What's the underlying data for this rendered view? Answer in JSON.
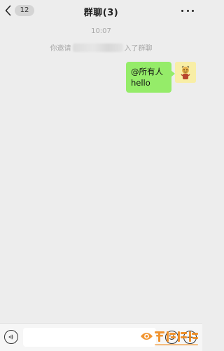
{
  "header": {
    "back_badge": "12",
    "title": "群聊(3)"
  },
  "messages": {
    "timestamp": "10:07",
    "system_prefix": "你邀请",
    "system_suffix": "入了群聊",
    "bubble_line1": "@所有人",
    "bubble_line2": "hello"
  },
  "input_bar": {
    "placeholder": ""
  },
  "watermark": {
    "text": "亏讯游戏",
    "url": "www.qxzfm.com"
  },
  "colors": {
    "background": "#ededed",
    "bubble": "#95ec69",
    "avatar_bg": "#f8eea6",
    "watermark_orange": "#f08a1c"
  },
  "icons": {
    "back": "chevron-left-icon",
    "more": "more-horizontal-icon",
    "voice": "voice-icon",
    "emoji": "emoji-icon",
    "plus": "plus-icon"
  }
}
